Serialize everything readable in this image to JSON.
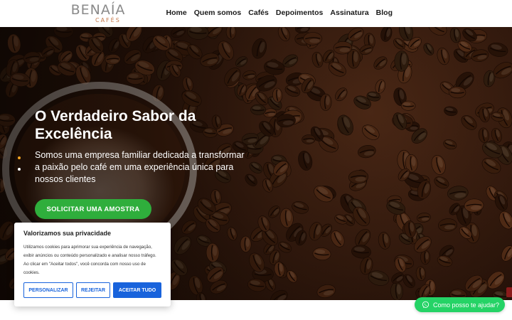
{
  "logo": {
    "brand": "BENAÍA",
    "sub": "CAFÉS"
  },
  "nav": {
    "items": [
      {
        "label": "Home"
      },
      {
        "label": "Quem somos"
      },
      {
        "label": "Cafés"
      },
      {
        "label": "Depoimentos"
      },
      {
        "label": "Assinatura"
      },
      {
        "label": "Blog"
      }
    ]
  },
  "hero": {
    "title": "O Verdadeiro Sabor da Excelência",
    "text": "Somos uma empresa familiar dedicada a transformar a paixão pelo café em uma experiência única para nossos clientes",
    "cta": "SOLICITAR UMA AMOSTRA"
  },
  "cookie": {
    "title": "Valorizamos sua privacidade",
    "text": "Utilizamos cookies para aprimorar sua experiência de navegação, exibir anúncios ou conteúdo personalizado e analisar nosso tráfego. Ao clicar em \"Aceitar todos\", você concorda com nosso uso de cookies.",
    "customize": "PERSONALIZAR",
    "reject": "REJEITAR",
    "accept": "ACEITAR TUDO"
  },
  "whatsapp": {
    "label": "Como posso te ajudar?",
    "icon": "whatsapp-icon"
  },
  "colors": {
    "accent_green": "#2fae3c",
    "cookie_blue": "#1863dc",
    "whatsapp_green": "#25d366",
    "logo_copper": "#c77b4d"
  }
}
